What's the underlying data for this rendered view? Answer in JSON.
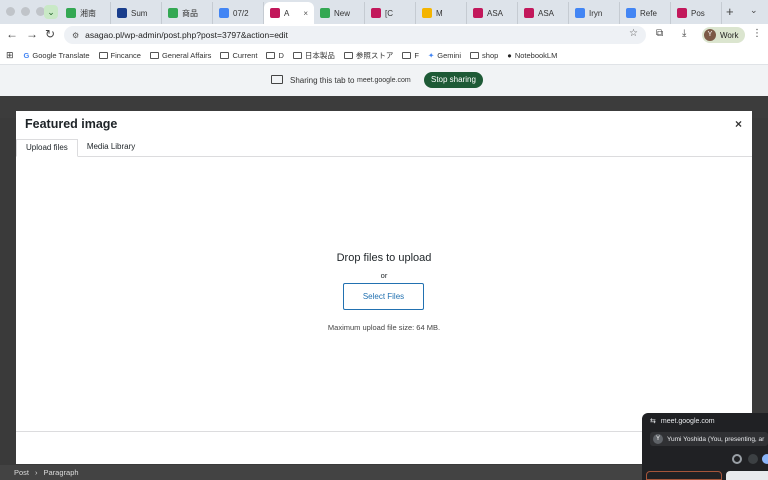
{
  "browser": {
    "tabs": [
      {
        "label": "湘南",
        "color": "#34a853"
      },
      {
        "label": "Sum",
        "color": "#1a3e8c"
      },
      {
        "label": "商品",
        "color": "#34a853"
      },
      {
        "label": "07/2",
        "color": "#4285f4"
      },
      {
        "label": "A",
        "color": "#c2185b",
        "active": true
      },
      {
        "label": "New",
        "color": "#34a853"
      },
      {
        "label": "[C",
        "color": "#c2185b"
      },
      {
        "label": "M",
        "color": "#f4b400"
      },
      {
        "label": "ASA",
        "color": "#c2185b"
      },
      {
        "label": "ASA",
        "color": "#c2185b"
      },
      {
        "label": "Iryn",
        "color": "#4285f4"
      },
      {
        "label": "Refe",
        "color": "#4285f4"
      },
      {
        "label": "Pos",
        "color": "#c2185b"
      }
    ],
    "url": "asagao.pl/wp-admin/post.php?post=3797&action=edit",
    "profile_label": "Work",
    "profile_initial": "Y",
    "bookmarks": [
      {
        "label": "Google Translate",
        "icon": "translate-icon"
      },
      {
        "label": "Fincance",
        "icon": "folder-icon"
      },
      {
        "label": "General Affairs",
        "icon": "folder-icon"
      },
      {
        "label": "Current",
        "icon": "folder-icon"
      },
      {
        "label": "D",
        "icon": "folder-icon"
      },
      {
        "label": "日本製品",
        "icon": "folder-icon"
      },
      {
        "label": "参照ストア",
        "icon": "folder-icon"
      },
      {
        "label": "F",
        "icon": "folder-icon"
      },
      {
        "label": "Gemini",
        "icon": "gemini-icon"
      },
      {
        "label": "shop",
        "icon": "folder-icon"
      },
      {
        "label": "NotebookLM",
        "icon": "notebooklm-icon"
      }
    ]
  },
  "share_bar": {
    "text": "Sharing this tab to",
    "host": "meet.google.com",
    "stop_label": "Stop sharing"
  },
  "modal": {
    "title": "Featured image",
    "close_glyph": "×",
    "tabs": [
      {
        "label": "Upload files",
        "active": true
      },
      {
        "label": "Media Library",
        "active": false
      }
    ],
    "drop_title": "Drop files to upload",
    "or_text": "or",
    "select_button": "Select Files",
    "max_size": "Maximum upload file size: 64 MB."
  },
  "editor": {
    "breadcrumb_root": "Post",
    "breadcrumb_sep": "›",
    "breadcrumb_leaf": "Paragraph"
  },
  "meet_window": {
    "host": "meet.google.com",
    "participant_initial": "Y",
    "participant": "Yumi Yoshida (You, presenting, ar"
  },
  "colors": {
    "accent": "#2271b1",
    "stop_sharing": "#1e5a36"
  }
}
